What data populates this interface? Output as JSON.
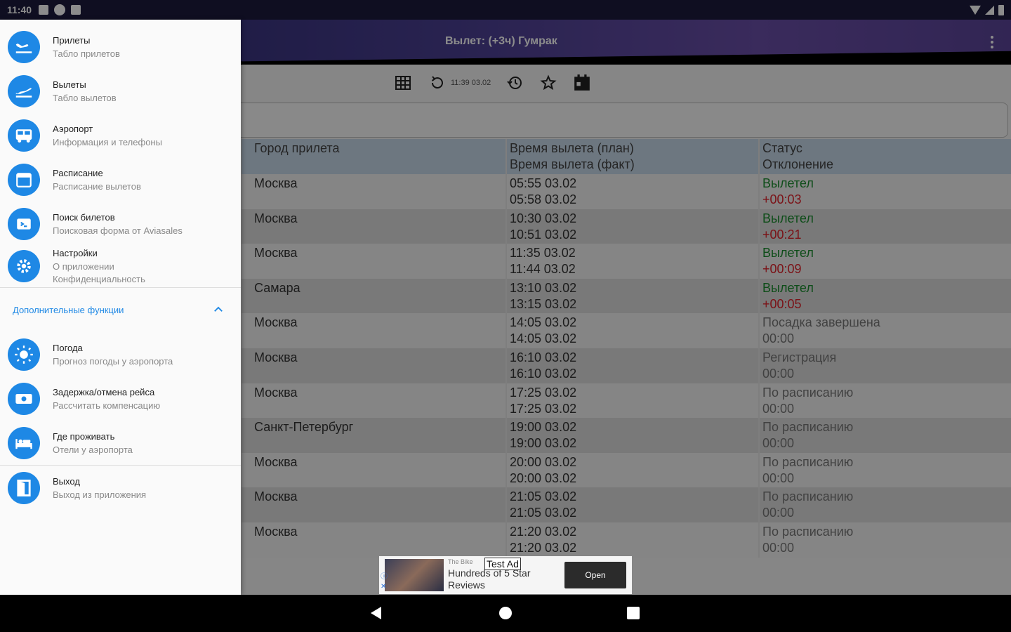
{
  "status_bar": {
    "time": "11:40"
  },
  "app_bar": {
    "title": "Вылет: (+3ч) Гумрак"
  },
  "toolbar": {
    "refresh_time": "11:39 03.02"
  },
  "table": {
    "headers": {
      "col1": "Город прилета",
      "col2_line1": "Время вылета (план)",
      "col2_line2": "Время вылета (факт)",
      "col3_line1": "Статус",
      "col3_line2": "Отклонение"
    },
    "rows": [
      {
        "city": "Москва",
        "plan": "05:55 03.02",
        "fact": "05:58 03.02",
        "status": "Вылетел",
        "deviation": "+00:03",
        "status_kind": "green",
        "dev_kind": "red"
      },
      {
        "city": "Москва",
        "plan": "10:30 03.02",
        "fact": "10:51 03.02",
        "status": "Вылетел",
        "deviation": "+00:21",
        "status_kind": "green",
        "dev_kind": "red"
      },
      {
        "city": "Москва",
        "plan": "11:35 03.02",
        "fact": "11:44 03.02",
        "status": "Вылетел",
        "deviation": "+00:09",
        "status_kind": "green",
        "dev_kind": "red"
      },
      {
        "city": "Самара",
        "plan": "13:10 03.02",
        "fact": "13:15 03.02",
        "status": "Вылетел",
        "deviation": "+00:05",
        "status_kind": "green",
        "dev_kind": "red"
      },
      {
        "city": "Москва",
        "plan": "14:05 03.02",
        "fact": "14:05 03.02",
        "status": "Посадка завершена",
        "deviation": "00:00",
        "status_kind": "grey",
        "dev_kind": "grey"
      },
      {
        "city": "Москва",
        "plan": "16:10 03.02",
        "fact": "16:10 03.02",
        "status": "Регистрация",
        "deviation": "00:00",
        "status_kind": "grey",
        "dev_kind": "grey"
      },
      {
        "city": "Москва",
        "plan": "17:25 03.02",
        "fact": "17:25 03.02",
        "status": "По расписанию",
        "deviation": "00:00",
        "status_kind": "grey",
        "dev_kind": "grey"
      },
      {
        "city": "Санкт-Петербург",
        "plan": "19:00 03.02",
        "fact": "19:00 03.02",
        "status": "По расписанию",
        "deviation": "00:00",
        "status_kind": "grey",
        "dev_kind": "grey"
      },
      {
        "city": "Москва",
        "plan": "20:00 03.02",
        "fact": "20:00 03.02",
        "status": "По расписанию",
        "deviation": "00:00",
        "status_kind": "grey",
        "dev_kind": "grey"
      },
      {
        "city": "Москва",
        "plan": "21:05 03.02",
        "fact": "21:05 03.02",
        "status": "По расписанию",
        "deviation": "00:00",
        "status_kind": "grey",
        "dev_kind": "grey"
      },
      {
        "city": "Москва",
        "plan": "21:20 03.02",
        "fact": "21:20 03.02",
        "status": "По расписанию",
        "deviation": "00:00",
        "status_kind": "grey",
        "dev_kind": "grey"
      }
    ]
  },
  "ad": {
    "badge": "Test Ad",
    "small": "The Bike",
    "text": "Hundreds of 5 Star Reviews",
    "open_label": "Open"
  },
  "drawer": {
    "items": [
      {
        "title": "Прилеты",
        "subtitle": "Табло прилетов",
        "icon": "plane-landing-icon"
      },
      {
        "title": "Вылеты",
        "subtitle": "Табло вылетов",
        "icon": "plane-takeoff-icon"
      },
      {
        "title": "Аэропорт",
        "subtitle": "Информация и телефоны",
        "icon": "bus-icon"
      },
      {
        "title": "Расписание",
        "subtitle": "Расписание вылетов",
        "icon": "calendar-icon"
      },
      {
        "title": "Поиск билетов",
        "subtitle": "Поисковая форма от Aviasales",
        "icon": "ticket-icon"
      },
      {
        "title": "Настройки",
        "subtitle": "О приложении",
        "subtitle2": "Конфиденциальность",
        "icon": "settings-icon"
      }
    ],
    "section_title": "Дополнительные функции",
    "extra_items": [
      {
        "title": "Погода",
        "subtitle": "Прогноз погоды у аэропорта",
        "icon": "sun-icon"
      },
      {
        "title": "Задержка/отмена рейса",
        "subtitle": "Рассчитать компенсацию",
        "icon": "money-icon"
      },
      {
        "title": "Где проживать",
        "subtitle": "Отели у аэропорта",
        "icon": "bed-icon"
      }
    ],
    "exit": {
      "title": "Выход",
      "subtitle": "Выход из приложения",
      "icon": "exit-icon"
    }
  }
}
